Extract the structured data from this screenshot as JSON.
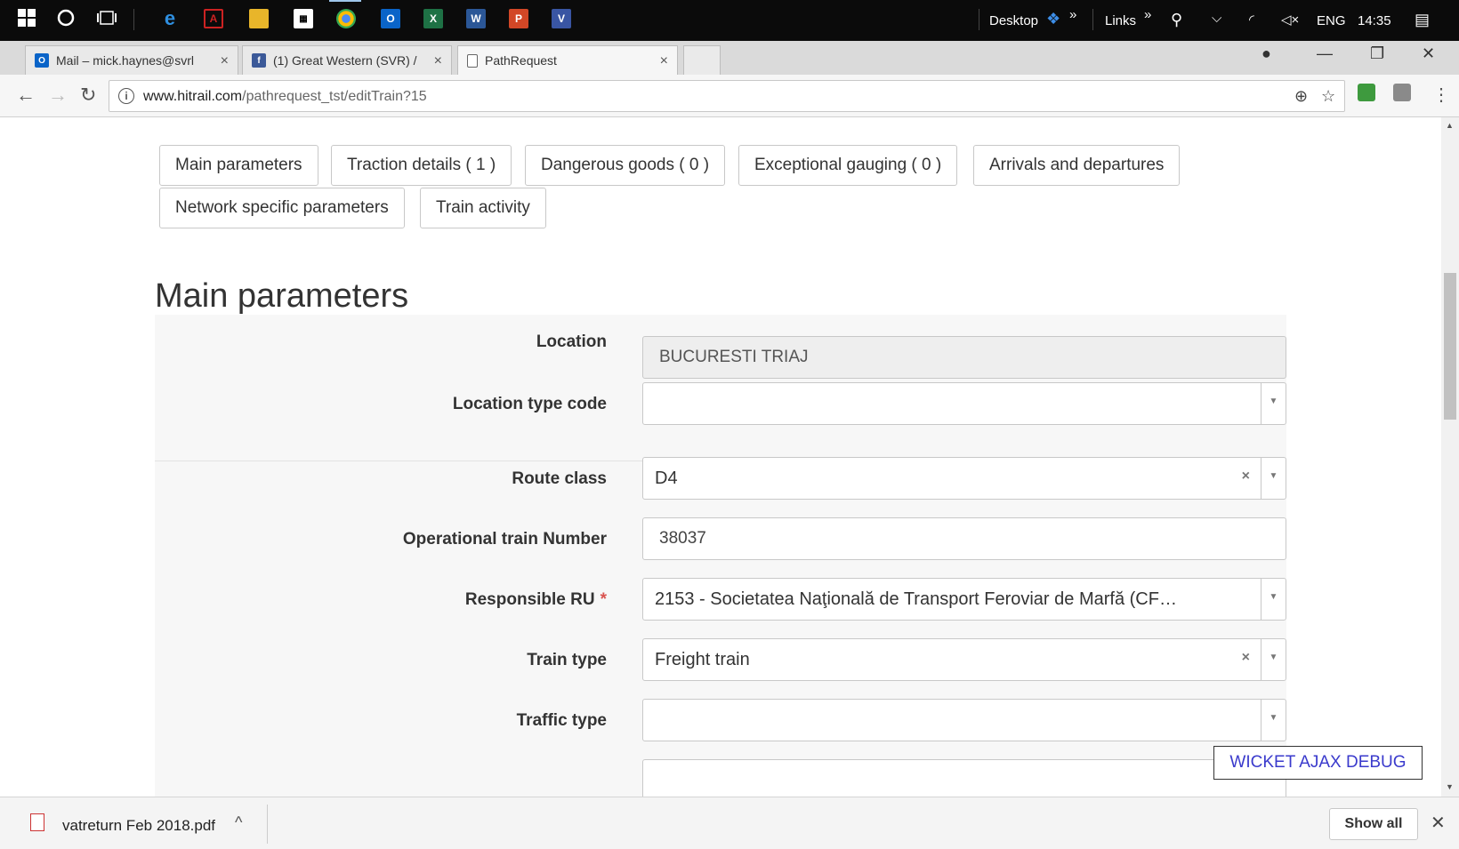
{
  "taskbar": {
    "desktop_label": "Desktop",
    "links_label": "Links",
    "chevron": "»",
    "lang": "ENG",
    "time": "14:35"
  },
  "tabs": [
    {
      "title": "Mail – mick.haynes@svrl",
      "favicon": "outlook-icon"
    },
    {
      "title": "(1) Great Western (SVR) /",
      "favicon": "facebook-icon"
    },
    {
      "title": "PathRequest",
      "favicon": "page-icon"
    }
  ],
  "address": {
    "host": "www.hitrail.com",
    "path": "/pathrequest_tst/editTrain?15"
  },
  "tab_buttons": [
    "Main parameters",
    "Traction details ( 1 )",
    "Dangerous goods ( 0 )",
    "Exceptional gauging ( 0 )",
    "Arrivals and departures",
    "Network specific parameters",
    "Train activity"
  ],
  "section_title": "Main parameters",
  "form": {
    "location": {
      "label": "Location",
      "value": "BUCURESTI TRIAJ"
    },
    "location_type_code": {
      "label": "Location type code",
      "value": ""
    },
    "route_class": {
      "label": "Route class",
      "value": "D4"
    },
    "operational_train_number": {
      "label": "Operational train Number",
      "value": "38037"
    },
    "responsible_ru": {
      "label": "Responsible RU",
      "required_mark": "*",
      "value": "2153 - Societatea Naţională de Transport Feroviar de Marfă (CF…"
    },
    "train_type": {
      "label": "Train type",
      "value": "Freight train"
    },
    "traffic_type": {
      "label": "Traffic type",
      "value": ""
    }
  },
  "debug_button": "WICKET AJAX DEBUG",
  "download": {
    "filename": "vatreturn Feb 2018.pdf",
    "show_all": "Show all"
  },
  "colors": {
    "taskbar": "#0b0b0b",
    "link_blue": "#3a3acc",
    "required_red": "#d9534f"
  }
}
